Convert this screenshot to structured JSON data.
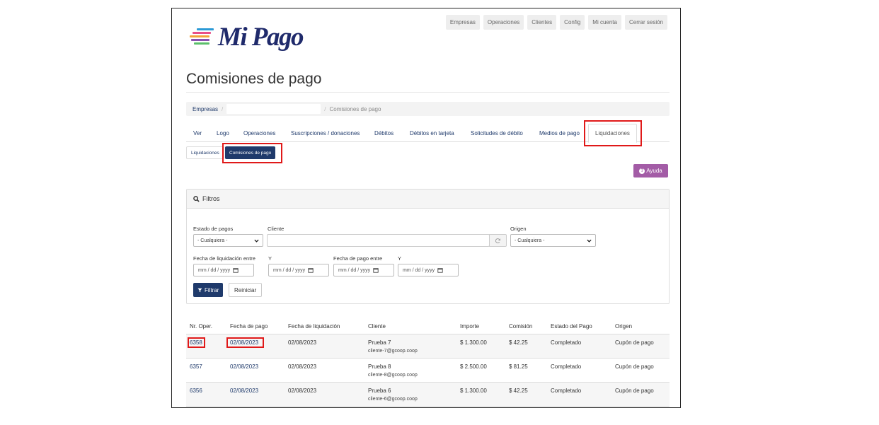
{
  "logo": {
    "text": "Mi Pago"
  },
  "topnav": [
    "Empresas",
    "Operaciones",
    "Clientes",
    "Config",
    "Mi cuenta",
    "Cerrar sesión"
  ],
  "page": {
    "title": "Comisiones de pago"
  },
  "breadcrumb": {
    "first": "Empresas",
    "last": "Comisiones de pago"
  },
  "tabs": [
    "Ver",
    "Logo",
    "Operaciones",
    "Suscripciones / donaciones",
    "Débitos",
    "Débitos en tarjeta",
    "Solicitudes de débito",
    "Medios de pago",
    "Liquidaciones"
  ],
  "subtabs": [
    "Liquidaciones",
    "Comisiones de pago"
  ],
  "help": {
    "label": "Ayuda"
  },
  "filters": {
    "title": "Filtros",
    "estado_label": "Estado de pagos",
    "estado_value": "- Cualquiera -",
    "cliente_label": "Cliente",
    "origen_label": "Origen",
    "origen_value": "- Cualquiera -",
    "fecha_liq_label": "Fecha de liquidación entre",
    "y_label": "Y",
    "fecha_pago_label": "Fecha de pago entre",
    "date_placeholder": "mm / dd / yyyy",
    "filter_button": "Filtrar",
    "reset_button": "Reiniciar"
  },
  "table": {
    "headers": [
      "Nr. Oper.",
      "Fecha de pago",
      "Fecha de liquidación",
      "Cliente",
      "Importe",
      "Comisión",
      "Estado del Pago",
      "Origen"
    ],
    "rows": [
      {
        "nr": "6358",
        "fecha_pago": "02/08/2023",
        "fecha_liq": "02/08/2023",
        "cliente": "Prueba 7",
        "email": "cliente-7@gcoop.coop",
        "importe": "$ 1.300.00",
        "comision": "$ 42.25",
        "estado": "Completado",
        "origen": "Cupón de pago"
      },
      {
        "nr": "6357",
        "fecha_pago": "02/08/2023",
        "fecha_liq": "02/08/2023",
        "cliente": "Prueba 8",
        "email": "cliente-8@gcoop.coop",
        "importe": "$ 2.500.00",
        "comision": "$ 81.25",
        "estado": "Completado",
        "origen": "Cupón de pago"
      },
      {
        "nr": "6356",
        "fecha_pago": "02/08/2023",
        "fecha_liq": "02/08/2023",
        "cliente": "Prueba 6",
        "email": "cliente-6@gcoop.coop",
        "importe": "$ 1.300.00",
        "comision": "$ 42.25",
        "estado": "Completado",
        "origen": "Cupón de pago"
      }
    ]
  },
  "colors": {
    "primary": "#1f3a6b",
    "help": "#a35ca6",
    "highlight": "#e01919"
  }
}
